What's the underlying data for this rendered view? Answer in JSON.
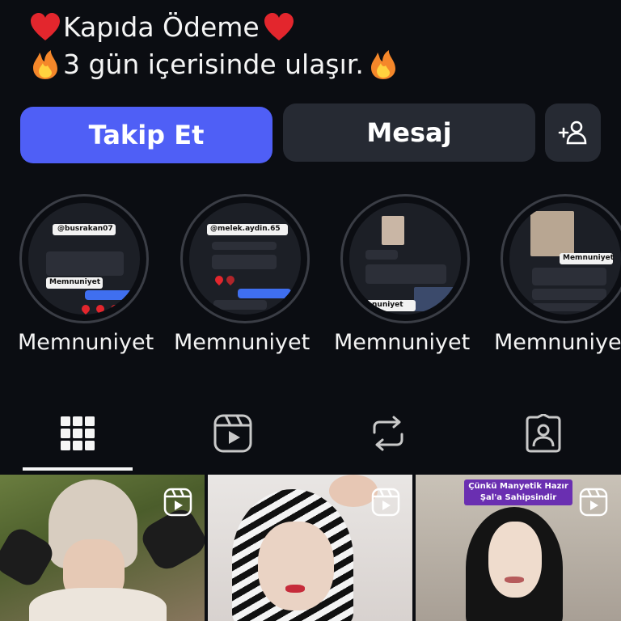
{
  "bio": {
    "line1": "Kapıda Ödeme",
    "line2": "3 gün içerisinde ulaşır."
  },
  "actions": {
    "follow_label": "Takip Et",
    "message_label": "Mesaj",
    "add_user_icon": "add-user-icon"
  },
  "highlights": [
    {
      "label": "Memnuniyet",
      "mention": "@busrakan07",
      "caption": "Memnuniyet"
    },
    {
      "label": "Memnuniyet",
      "mention": "@melek.aydin.65",
      "caption": ""
    },
    {
      "label": "Memnuniyet",
      "mention": "",
      "caption": "nuniyet"
    },
    {
      "label": "Memnuniyet",
      "mention": "",
      "caption": "Memnuniyet"
    }
  ],
  "tabs": [
    {
      "icon": "grid-icon",
      "active": true
    },
    {
      "icon": "reels-icon",
      "active": false
    },
    {
      "icon": "repost-icon",
      "active": false
    },
    {
      "icon": "tagged-icon",
      "active": false
    }
  ],
  "grid": {
    "tile3_banner": "Çünkü Manyetik Hazır Şal'a Sahipsindir"
  },
  "colors": {
    "background": "#0b0d12",
    "follow_button": "#4f5ff6",
    "secondary_button": "#262a33",
    "heart": "#e3262d",
    "fire": "#f5872a"
  }
}
